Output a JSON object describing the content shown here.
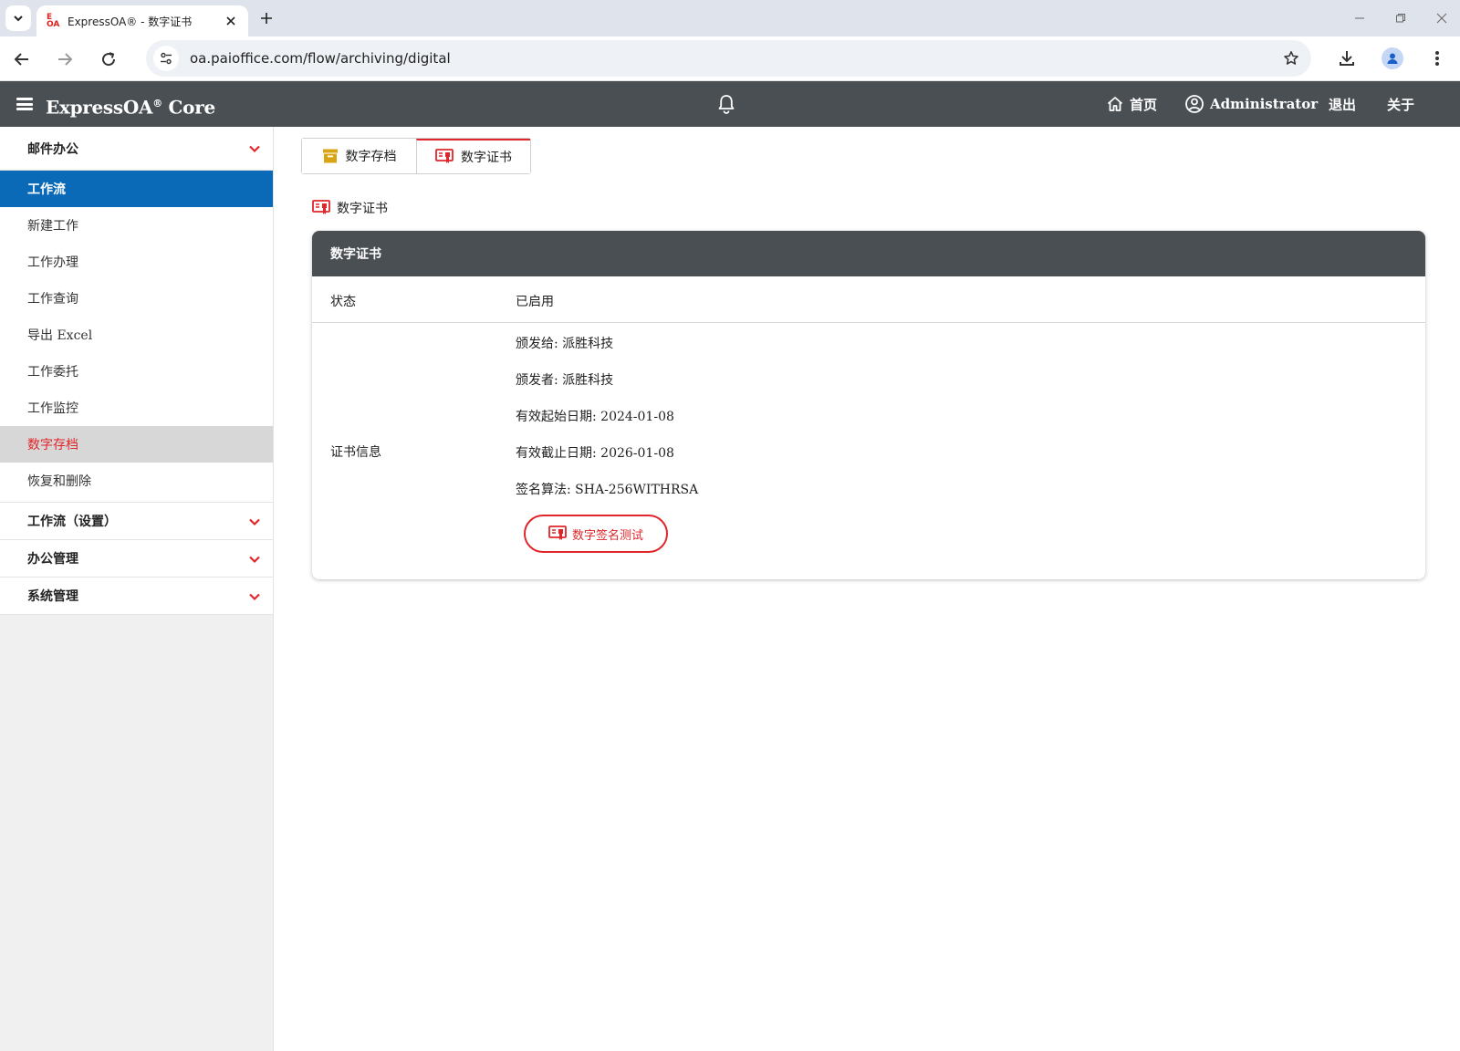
{
  "browser": {
    "tab_title": "ExpressOA® - 数字证书",
    "favicon_top": "E",
    "favicon_bottom": "OA",
    "url": "oa.paioffice.com/flow/archiving/digital"
  },
  "header": {
    "brand": "ExpressOA",
    "brand_reg": "®",
    "brand_suffix": " Core",
    "home_label": "首页",
    "user_label": "Administrator",
    "logout_label": "退出",
    "about_label": "关于"
  },
  "sidebar": {
    "group_mail": "邮件办公",
    "group_workflow": "工作流",
    "items": [
      {
        "label": "新建工作"
      },
      {
        "label": "工作办理"
      },
      {
        "label": "工作查询"
      },
      {
        "label": "导出 Excel"
      },
      {
        "label": "工作委托"
      },
      {
        "label": "工作监控"
      },
      {
        "label": "数字存档"
      },
      {
        "label": "恢复和删除"
      }
    ],
    "group_workflow_settings": "工作流（设置）",
    "group_office": "办公管理",
    "group_system": "系统管理"
  },
  "main": {
    "tabs": [
      {
        "label": "数字存档"
      },
      {
        "label": "数字证书"
      }
    ],
    "section_title": "数字证书",
    "card": {
      "title": "数字证书",
      "status_label": "状态",
      "status_value": "已启用",
      "info_label": "证书信息",
      "issued_to": "颁发给: 派胜科技",
      "issuer": "颁发者: 派胜科技",
      "valid_from": "有效起始日期: 2024-01-08",
      "valid_to": "有效截止日期: 2026-01-08",
      "algorithm": "签名算法: SHA-256WITHRSA",
      "test_button": "数字签名测试"
    }
  },
  "colors": {
    "accent_red": "#e0262b",
    "active_blue": "#0a6ab8",
    "header_dark": "#4a4f54",
    "archive_gold": "#d9a414"
  }
}
